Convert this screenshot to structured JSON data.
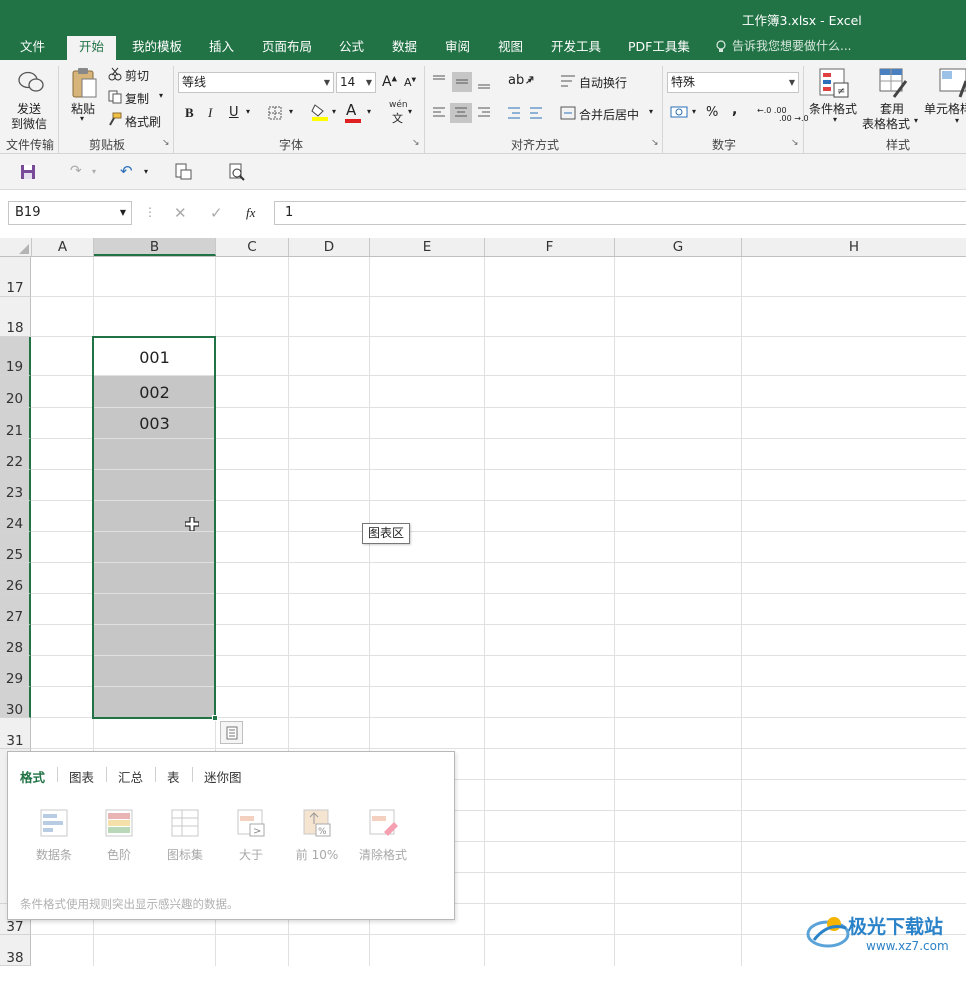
{
  "window": {
    "title": "工作簿3.xlsx - Excel"
  },
  "tabs": [
    "文件",
    "开始",
    "我的模板",
    "插入",
    "页面布局",
    "公式",
    "数据",
    "审阅",
    "视图",
    "开发工具",
    "PDF工具集"
  ],
  "active_tab": "开始",
  "tell_me": "告诉我您想要做什么...",
  "ribbon": {
    "groups": [
      "文件传输",
      "剪贴板",
      "字体",
      "对齐方式",
      "数字",
      "样式"
    ],
    "send_wechat": [
      "发送",
      "到微信"
    ],
    "paste": "粘贴",
    "cut": "剪切",
    "copy": "复制",
    "format_painter": "格式刷",
    "font_name": "等线",
    "font_size": "14",
    "bold": "B",
    "italic": "I",
    "underline": "U",
    "wrap_text": "自动换行",
    "merge_center": "合并后居中",
    "number_format": "特殊",
    "percent": "%",
    "comma": ",",
    "cond_format": "条件格式",
    "table_format": [
      "套用",
      "表格格式"
    ],
    "cell_styles": "单元格样式",
    "grow_font": "A",
    "shrink_font": "A",
    "wen": "wén",
    "wen_char": "文",
    "dec_inc": "←.0 .00",
    "dec_dec": ".00 →.0",
    "font_color_letter": "A"
  },
  "formula_bar": {
    "name_box": "B19",
    "fx": "fx",
    "content": "1"
  },
  "columns": [
    "A",
    "B",
    "C",
    "D",
    "E",
    "F",
    "G",
    "H"
  ],
  "selected_column": "B",
  "rows": [
    "17",
    "18",
    "19",
    "20",
    "21",
    "22",
    "23",
    "24",
    "25",
    "26",
    "27",
    "28",
    "29",
    "30",
    "31",
    "37",
    "38"
  ],
  "cells": {
    "B19": "001",
    "B20": "002",
    "B21": "003"
  },
  "tooltip": "图表区",
  "quick_analysis": {
    "tabs": [
      "格式",
      "图表",
      "汇总",
      "表",
      "迷你图"
    ],
    "active_tab": "格式",
    "items": [
      "数据条",
      "色阶",
      "图标集",
      "大于",
      "前 10%",
      "清除格式"
    ],
    "description": "条件格式使用规则突出显示感兴趣的数据。"
  },
  "watermark": {
    "text": "极光下载站",
    "url": "www.xz7.com"
  },
  "colors": {
    "excel_green": "#217346",
    "selection_fill": "#c6c6c6",
    "ribbon_bg": "#f3f3f3"
  }
}
